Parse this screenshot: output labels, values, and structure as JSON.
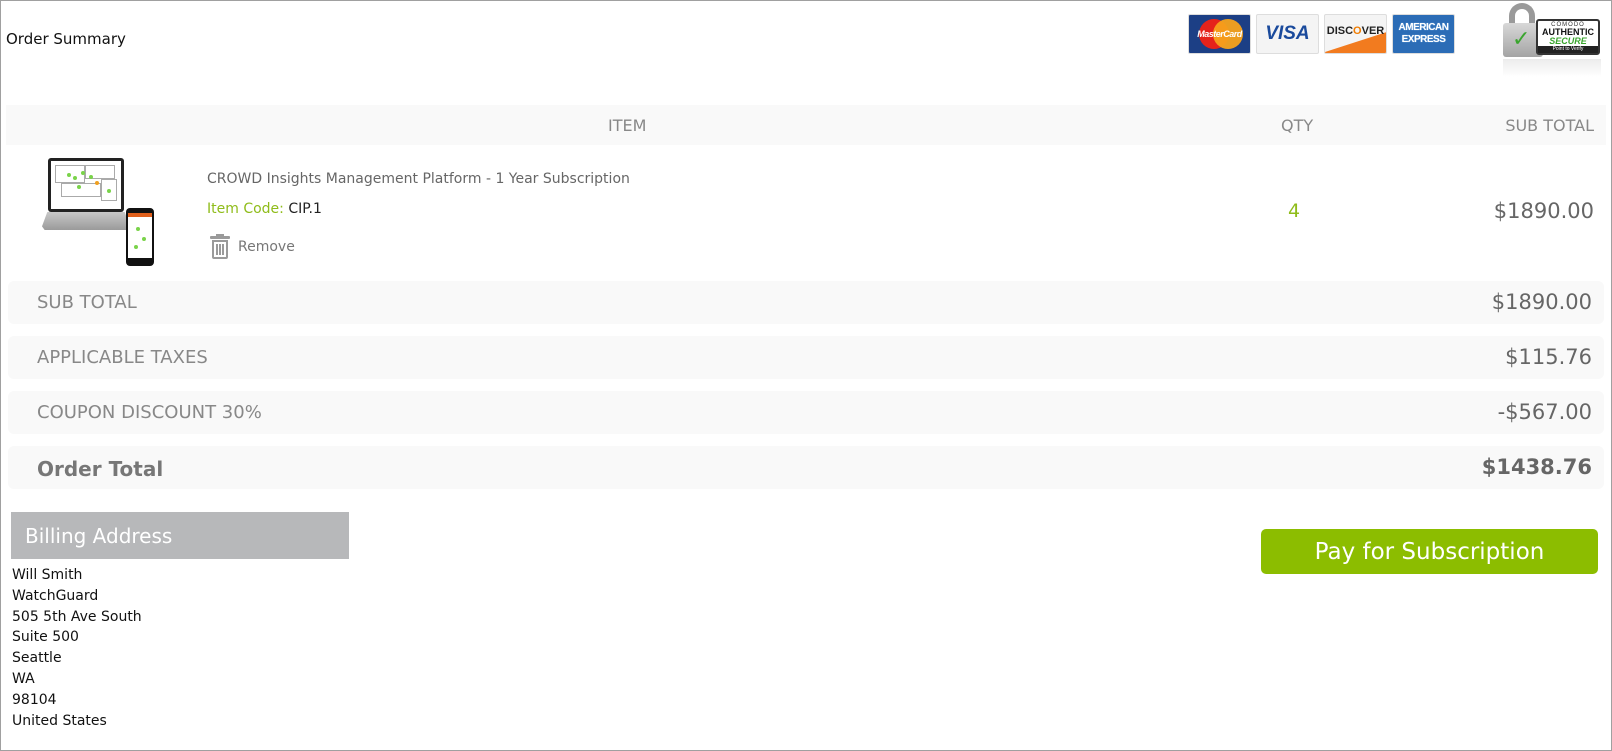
{
  "page": {
    "title": "Order Summary"
  },
  "payment_badges": [
    {
      "name": "mastercard",
      "label": "MasterCard"
    },
    {
      "name": "visa",
      "label": "VISA"
    },
    {
      "name": "discover",
      "label": "DISCOVER"
    },
    {
      "name": "amex",
      "label_1": "AMERICAN",
      "label_2": "EXPRESS"
    }
  ],
  "security_seal": {
    "brand": "COMODO",
    "line1": "AUTHENTIC",
    "line2": "SECURE",
    "line3": "Point to Verify"
  },
  "table": {
    "headers": {
      "item": "ITEM",
      "qty": "QTY",
      "subtotal": "SUB TOTAL"
    },
    "rows": [
      {
        "name": "CROWD Insights Management Platform - 1 Year Subscription",
        "item_code_label": "Item Code:",
        "item_code": "CIP.1",
        "remove_label": "Remove",
        "qty": "4",
        "subtotal": "$1890.00"
      }
    ]
  },
  "summary": {
    "subtotal": {
      "label": "SUB TOTAL",
      "value": "$1890.00"
    },
    "taxes": {
      "label": "APPLICABLE TAXES",
      "value": "$115.76"
    },
    "coupon": {
      "label": "COUPON DISCOUNT 30%",
      "value": "-$567.00"
    },
    "total": {
      "label": "Order Total",
      "value": "$1438.76"
    }
  },
  "billing": {
    "heading": "Billing Address",
    "lines": [
      "Will Smith",
      "WatchGuard",
      "505 5th Ave South",
      "Suite 500",
      "Seattle",
      "WA",
      "98104",
      "United States"
    ]
  },
  "actions": {
    "pay_label": "Pay for Subscription"
  },
  "colors": {
    "accent_green": "#8cbd00",
    "header_bg": "#f9f9f9",
    "billing_head_bg": "#b7b8ba"
  }
}
